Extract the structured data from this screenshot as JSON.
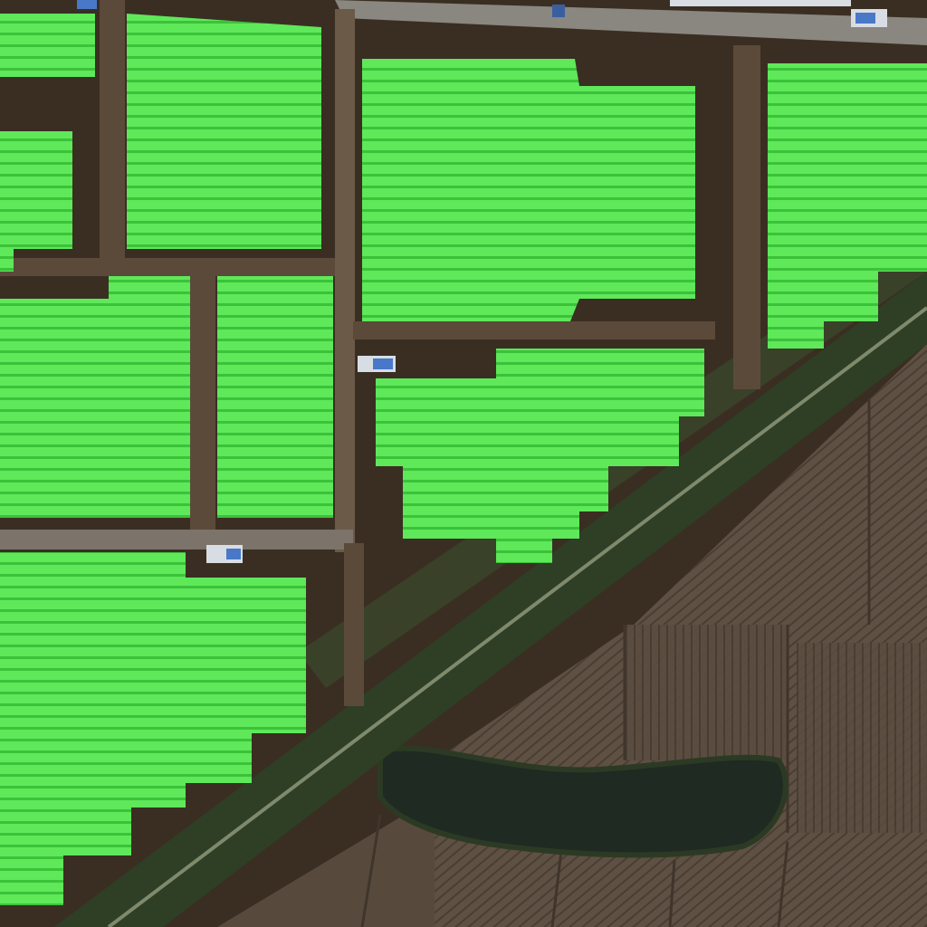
{
  "image": {
    "kind": "aerial-photo",
    "subject": "greenhouse-segmentation-mask",
    "text": []
  },
  "colors": {
    "ground": "#3a2e22",
    "dirt_road": "#6b5a48",
    "paved_road": "#8a8680",
    "field": "#5e5043",
    "field_line": "#4a3e33",
    "pond": "#1e2a22",
    "trees": "#2e3f25",
    "mask": "#5ee85a",
    "mask_stripe": "#3cc23a",
    "vehicle": "#d8dde4",
    "roof_blue": "#4a78c8"
  },
  "mask_regions": {
    "count": 8
  }
}
